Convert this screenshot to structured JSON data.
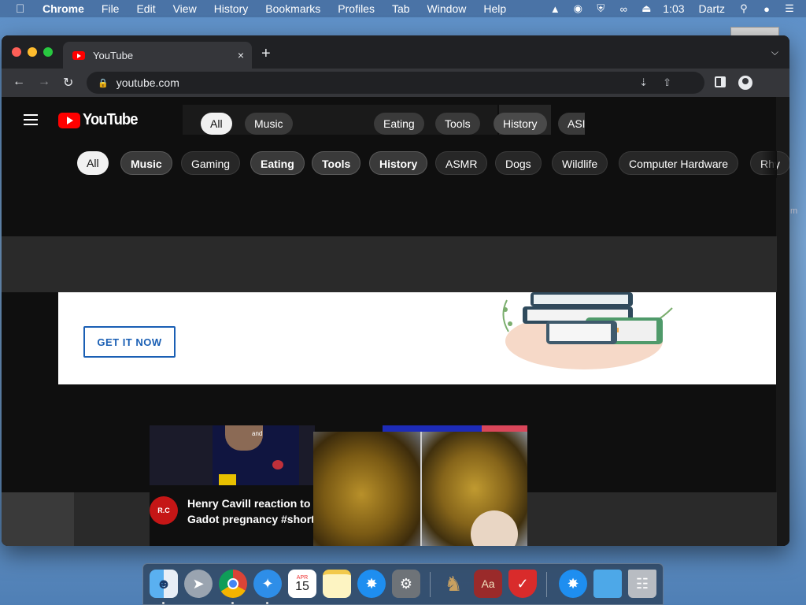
{
  "menubar": {
    "app_name": "Chrome",
    "items": [
      "File",
      "Edit",
      "View",
      "History",
      "Bookmarks",
      "Profiles",
      "Tab",
      "Window",
      "Help"
    ],
    "clock": "1:03",
    "user": "Dartz",
    "status_icons": [
      "malwarebytes-icon",
      "vpn-icon",
      "shield-check-icon",
      "creative-cloud-icon",
      "eject-icon"
    ]
  },
  "browser": {
    "tab_title": "YouTube",
    "tab_close": "×",
    "new_tab": "+",
    "url": "youtube.com"
  },
  "youtube": {
    "logo_text": "YouTube",
    "ghost_chips": [
      "All",
      "Music",
      "Eating",
      "Tools",
      "History",
      "ASI"
    ],
    "chips": [
      "All",
      "Music",
      "Gaming",
      "Eating",
      "Tools",
      "History",
      "ASMR",
      "Dogs",
      "Wildlife",
      "Computer Hardware",
      "Rhy"
    ],
    "active_chip": "All",
    "ad_button": "GET IT NOW",
    "video": {
      "title_line1": "Henry Cavill reaction to G",
      "title_line2": "Gadot pregnancy #shorts",
      "channel_badge": "R.C",
      "thumb_caption": "and"
    }
  },
  "colors": {
    "youtube_red": "#ff0000",
    "ad_accent": "#1a5fb4",
    "page_bg": "#0f0f0f"
  },
  "dock": {
    "apps": [
      "Finder",
      "Launchpad",
      "Chrome",
      "Safari",
      "Calendar",
      "Notes",
      "App Store",
      "System Preferences",
      "Chess",
      "Dictionary",
      "Shield",
      "App Store Downloads",
      "Folder",
      "Trash"
    ],
    "calendar_month": "APR",
    "calendar_day": "15",
    "dictionary_label": "Aa"
  }
}
